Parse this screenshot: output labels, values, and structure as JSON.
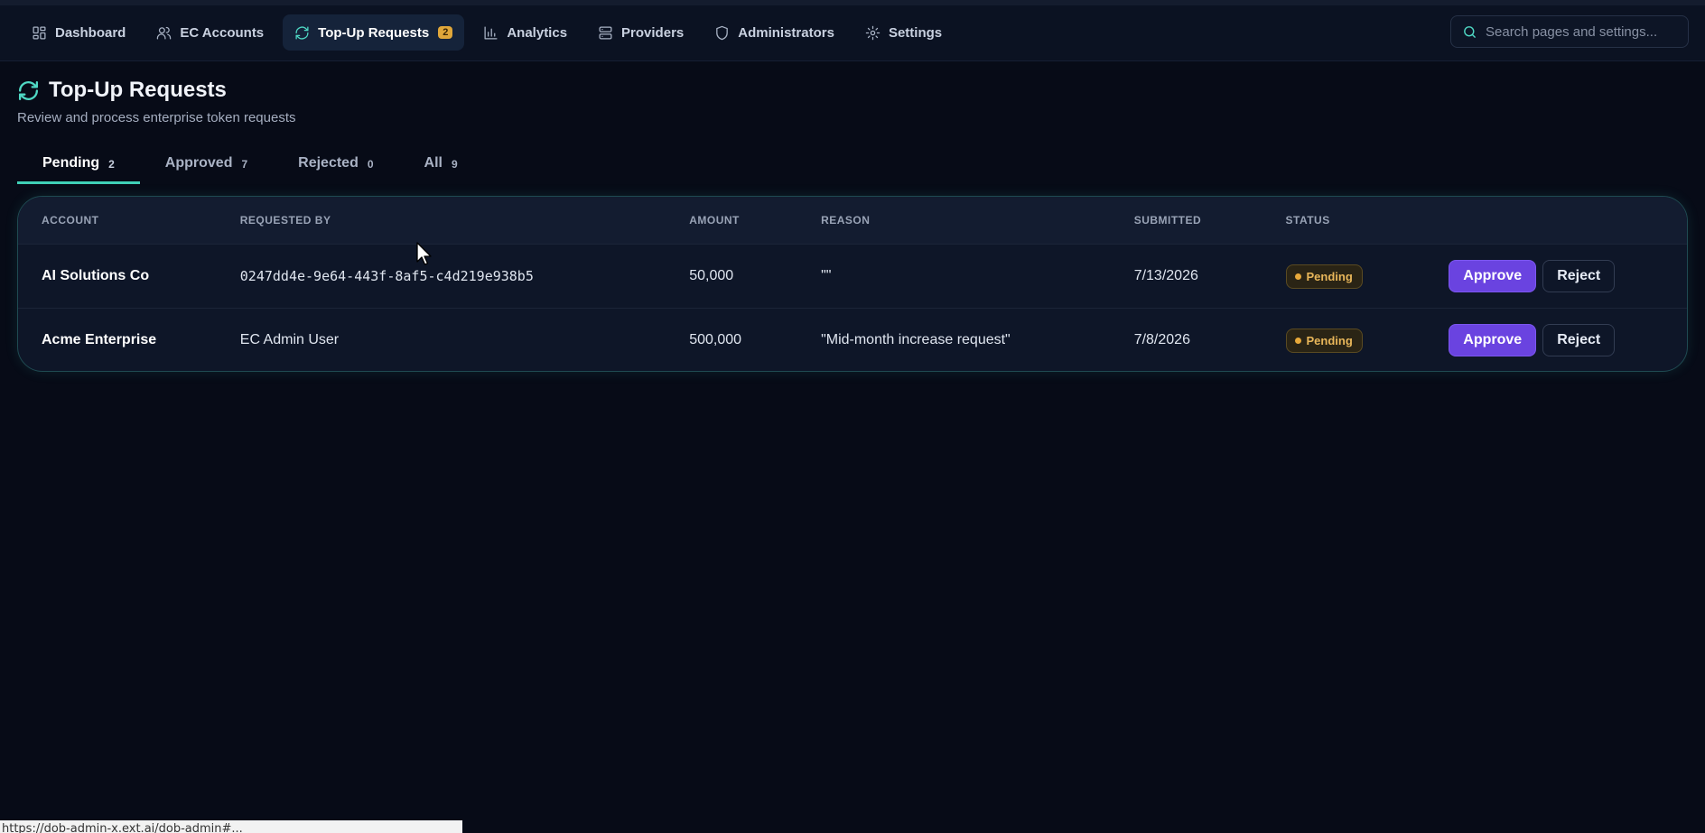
{
  "nav": {
    "items": [
      {
        "label": "Dashboard",
        "icon": "grid-icon",
        "active": false
      },
      {
        "label": "EC Accounts",
        "icon": "users-icon",
        "active": false
      },
      {
        "label": "Top-Up Requests",
        "icon": "refresh-icon",
        "active": true,
        "badge": "2"
      },
      {
        "label": "Analytics",
        "icon": "bar-chart-icon",
        "active": false
      },
      {
        "label": "Providers",
        "icon": "server-icon",
        "active": false
      },
      {
        "label": "Administrators",
        "icon": "shield-icon",
        "active": false
      },
      {
        "label": "Settings",
        "icon": "gear-icon",
        "active": false
      }
    ]
  },
  "search": {
    "placeholder": "Search pages and settings..."
  },
  "page": {
    "title": "Top-Up Requests",
    "subtitle": "Review and process enterprise token requests"
  },
  "tabs": [
    {
      "label": "Pending",
      "count": "2",
      "active": true
    },
    {
      "label": "Approved",
      "count": "7",
      "active": false
    },
    {
      "label": "Rejected",
      "count": "0",
      "active": false
    },
    {
      "label": "All",
      "count": "9",
      "active": false
    }
  ],
  "table": {
    "headers": [
      "ACCOUNT",
      "REQUESTED BY",
      "AMOUNT",
      "REASON",
      "SUBMITTED",
      "STATUS"
    ],
    "rows": [
      {
        "account": "AI Solutions Co",
        "requested_by": "0247dd4e-9e64-443f-8af5-c4d219e938b5",
        "amount": "50,000",
        "reason": "\"\"",
        "submitted": "7/13/2026",
        "status": "Pending",
        "approve_label": "Approve",
        "reject_label": "Reject"
      },
      {
        "account": "Acme Enterprise",
        "requested_by": "EC Admin User",
        "amount": "500,000",
        "reason": "\"Mid-month increase request\"",
        "submitted": "7/8/2026",
        "status": "Pending",
        "approve_label": "Approve",
        "reject_label": "Reject"
      }
    ]
  },
  "statusbar": {
    "url": "https://dob-admin-x.ext.ai/dob-admin#..."
  },
  "colors": {
    "accent": "#3fcfb6",
    "primary_button": "#6a43e0",
    "pending": "#e8b65a",
    "badge": "#e0a73a"
  }
}
